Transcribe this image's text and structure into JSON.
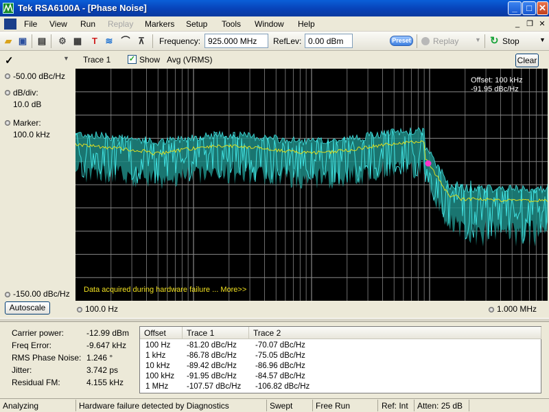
{
  "window": {
    "title": "Tek RSA6100A - [Phase Noise]"
  },
  "menu": [
    "File",
    "View",
    "Run",
    "Replay",
    "Markers",
    "Setup",
    "Tools",
    "Window",
    "Help"
  ],
  "toolbar": {
    "frequency_label": "Frequency:",
    "frequency_value": "925.000 MHz",
    "reflev_label": "RefLev:",
    "reflev_value": "0.00 dBm",
    "preset_label": "Preset",
    "replay_label": "Replay",
    "stop_label": "Stop"
  },
  "trace_bar": {
    "trace_label": "Trace 1",
    "show_label": "Show",
    "show_checked": true,
    "detector": "Avg (VRMS)",
    "clear_label": "Clear"
  },
  "left_panel": {
    "top_value": "-50.00 dBc/Hz",
    "div_label": "dB/div:",
    "div_value": "10.0 dB",
    "marker_label": "Marker:",
    "marker_value": "100.0 kHz",
    "bottom_value": "-150.00 dBc/Hz",
    "autoscale_label": "Autoscale"
  },
  "plot": {
    "offset_line1": "Offset: 100 kHz",
    "offset_line2": "-91.95 dBc/Hz",
    "hw_message": "Data acquired during hardware failure ... More>>",
    "x_start": "100.0 Hz",
    "x_stop": "1.000 MHz",
    "colors": {
      "trace": "#40e0e0",
      "fill": "#1f8a84",
      "avg": "#e0e020",
      "marker": "#ff33cc",
      "grid": "#888888"
    }
  },
  "measurements": [
    {
      "label": "Carrier power:",
      "value": "-12.99 dBm"
    },
    {
      "label": "Freq Error:",
      "value": "-9.647 kHz"
    },
    {
      "label": "RMS Phase Noise:",
      "value": "1.246 °"
    },
    {
      "label": "Jitter:",
      "value": "3.742 ps"
    },
    {
      "label": "Residual FM:",
      "value": "4.155 kHz"
    }
  ],
  "table": {
    "headers": [
      "Offset",
      "Trace 1",
      "Trace 2"
    ],
    "rows": [
      [
        "100 Hz",
        "-81.20 dBc/Hz",
        "-70.07 dBc/Hz"
      ],
      [
        "1 kHz",
        "-86.78 dBc/Hz",
        "-75.05 dBc/Hz"
      ],
      [
        "10 kHz",
        "-89.42 dBc/Hz",
        "-86.96 dBc/Hz"
      ],
      [
        "100 kHz",
        "-91.95 dBc/Hz",
        "-84.57 dBc/Hz"
      ],
      [
        "1 MHz",
        "-107.57 dBc/Hz",
        "-106.82 dBc/Hz"
      ]
    ]
  },
  "status": {
    "state": "Analyzing",
    "message": "Hardware failure detected by Diagnostics",
    "mode": "Swept",
    "trigger": "Free Run",
    "ref": "Ref: Int",
    "atten": "Atten: 25 dB"
  }
}
